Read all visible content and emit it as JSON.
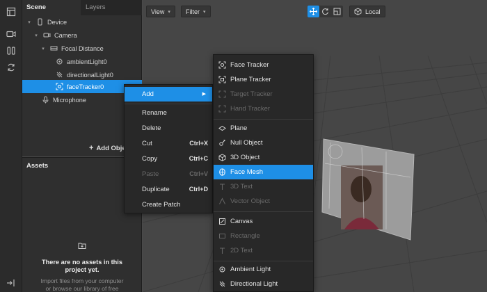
{
  "scene_panel": {
    "tabs": [
      "Scene",
      "Layers"
    ],
    "tree": [
      {
        "label": "Device",
        "icon": "phone-icon",
        "caret": "▾"
      },
      {
        "label": "Camera",
        "icon": "camera-icon",
        "caret": "▾"
      },
      {
        "label": "Focal Distance",
        "icon": "focal-distance-icon",
        "caret": "▾"
      },
      {
        "label": "ambientLight0",
        "icon": "ambient-light-icon",
        "caret": ""
      },
      {
        "label": "directionalLight0",
        "icon": "directional-light-icon",
        "caret": ""
      },
      {
        "label": "faceTracker0",
        "icon": "face-tracker-icon",
        "caret": ""
      },
      {
        "label": "Microphone",
        "icon": "microphone-icon",
        "caret": ""
      }
    ],
    "selected_item": "faceTracker0",
    "add_object_label": "Add Obje"
  },
  "assets_panel": {
    "title": "Assets",
    "empty_title_line1": "There are no assets in this",
    "empty_title_line2": "project yet.",
    "hint_line1": "Import files from your computer",
    "hint_line2": "or browse our library of free"
  },
  "viewport": {
    "view_label": "View",
    "filter_label": "Filter",
    "local_label": "Local",
    "chevron": "▾"
  },
  "context_menu": {
    "items": [
      {
        "label": "Add",
        "shortcut": "",
        "submenu": true,
        "state": "highlighted"
      },
      {
        "label": "Rename",
        "shortcut": "",
        "state": "normal"
      },
      {
        "label": "Delete",
        "shortcut": "",
        "state": "normal"
      },
      {
        "label": "Cut",
        "shortcut": "Ctrl+X",
        "state": "normal"
      },
      {
        "label": "Copy",
        "shortcut": "Ctrl+C",
        "state": "normal"
      },
      {
        "label": "Paste",
        "shortcut": "Ctrl+V",
        "state": "disabled"
      },
      {
        "label": "Duplicate",
        "shortcut": "Ctrl+D",
        "state": "normal"
      },
      {
        "label": "Create Patch",
        "shortcut": "",
        "state": "normal"
      }
    ]
  },
  "add_submenu": {
    "items": [
      {
        "label": "Face Tracker",
        "icon": "face-tracker-icon",
        "state": "normal"
      },
      {
        "label": "Plane Tracker",
        "icon": "plane-tracker-icon",
        "state": "normal"
      },
      {
        "label": "Target Tracker",
        "icon": "target-tracker-icon",
        "state": "disabled"
      },
      {
        "label": "Hand Tracker",
        "icon": "hand-tracker-icon",
        "state": "disabled"
      },
      {
        "label": "Plane",
        "icon": "plane-icon",
        "state": "normal"
      },
      {
        "label": "Null Object",
        "icon": "null-object-icon",
        "state": "normal"
      },
      {
        "label": "3D Object",
        "icon": "cube-icon",
        "state": "normal"
      },
      {
        "label": "Face Mesh",
        "icon": "face-mesh-icon",
        "state": "highlighted"
      },
      {
        "label": "3D Text",
        "icon": "text-3d-icon",
        "state": "disabled"
      },
      {
        "label": "Vector Object",
        "icon": "vector-object-icon",
        "state": "disabled"
      },
      {
        "label": "Canvas",
        "icon": "canvas-icon",
        "state": "normal"
      },
      {
        "label": "Rectangle",
        "icon": "rectangle-icon",
        "state": "disabled"
      },
      {
        "label": "2D Text",
        "icon": "text-2d-icon",
        "state": "disabled"
      },
      {
        "label": "Ambient Light",
        "icon": "ambient-light-icon",
        "state": "normal"
      },
      {
        "label": "Directional Light",
        "icon": "directional-light-icon",
        "state": "normal"
      }
    ]
  },
  "colors": {
    "accent": "#1e8fe6",
    "panel": "#2f2f2f",
    "viewport": "#464646",
    "menu": "#282828"
  }
}
